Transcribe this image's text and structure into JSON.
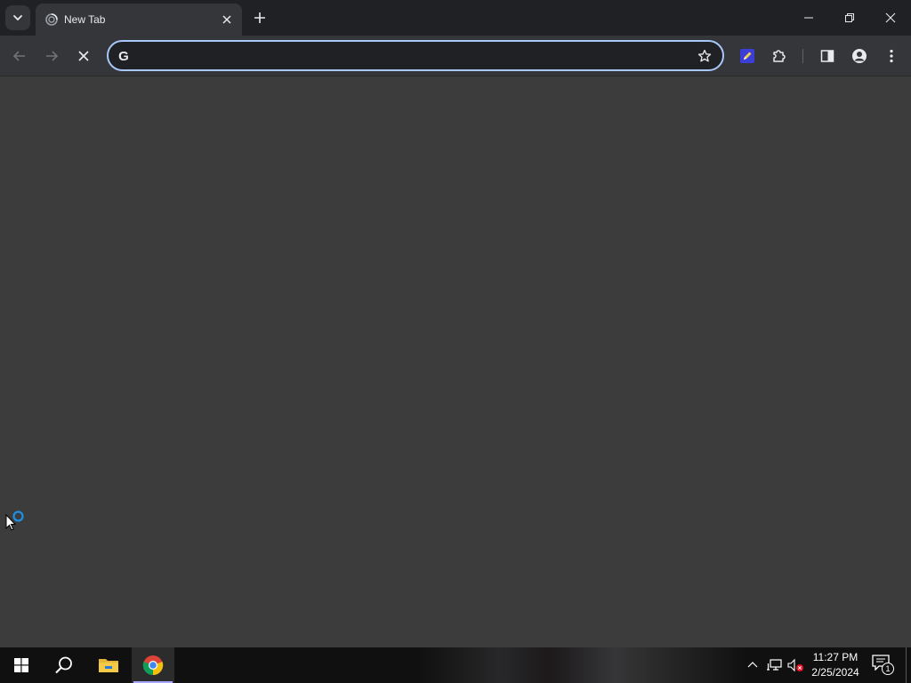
{
  "browser": {
    "tab": {
      "title": "New Tab"
    },
    "omnibox": {
      "value": "",
      "placeholder": ""
    },
    "colors": {
      "accent": "#a8c7fa",
      "tabstrip": "#202124",
      "toolbar": "#35363a",
      "content": "#3c3c3c"
    }
  },
  "icons": {
    "tab_search": "chevron-down-icon",
    "favicon": "loading-favicon-icon",
    "tab_close": "close-icon",
    "new_tab": "plus-icon",
    "back": "arrow-left-icon",
    "forward": "arrow-right-icon",
    "stop": "stop-icon",
    "omnibox_logo": "google-g-icon",
    "bookmark": "star-icon",
    "extension_pen": "pen-extension-icon",
    "extensions": "puzzle-icon",
    "side_panel": "side-panel-icon",
    "profile": "profile-icon",
    "menu": "kebab-menu-icon"
  },
  "omnibox_logo_text": "G",
  "taskbar": {
    "apps": [
      "start",
      "search",
      "file-explorer",
      "chrome"
    ],
    "clock": {
      "time": "11:27 PM",
      "date": "2/25/2024"
    },
    "notifications": {
      "count": "1"
    }
  }
}
